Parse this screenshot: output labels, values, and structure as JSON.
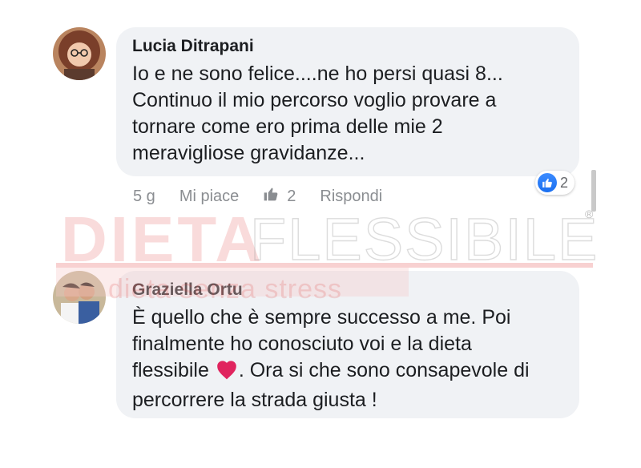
{
  "comments": [
    {
      "author": "Lucia Ditrapani",
      "text": "Io e ne sono felice....ne ho persi quasi 8...\nContinuo il mio percorso  voglio provare a\ntornare come ero prima delle mie 2\nmeravigliose gravidanze...",
      "time": "5 g",
      "like_label": "Mi piace",
      "like_count": "2",
      "reply_label": "Rispondi",
      "reaction_count": "2"
    },
    {
      "author": "Graziella Ortu",
      "text_part1": "È quello che è sempre successo a me. Poi\nfinalmente ho conosciuto voi e la dieta\nflessibile ",
      "text_part2": ". Ora si che sono consapevole di\npercorrere la strada giusta !"
    }
  ],
  "watermark": {
    "brand_part1": "DIETA",
    "brand_part2": "FLESSIBILE",
    "registered": "®",
    "tagline": "dieta senza stress"
  },
  "colors": {
    "bubble": "#f0f2f5",
    "meta_text": "#8a8d91",
    "like_blue": "#1877f2",
    "watermark_red": "#e03a3a",
    "heart": "#e0245e"
  },
  "icons": [
    "thumbs-up-icon",
    "heart-icon",
    "avatar-image"
  ]
}
